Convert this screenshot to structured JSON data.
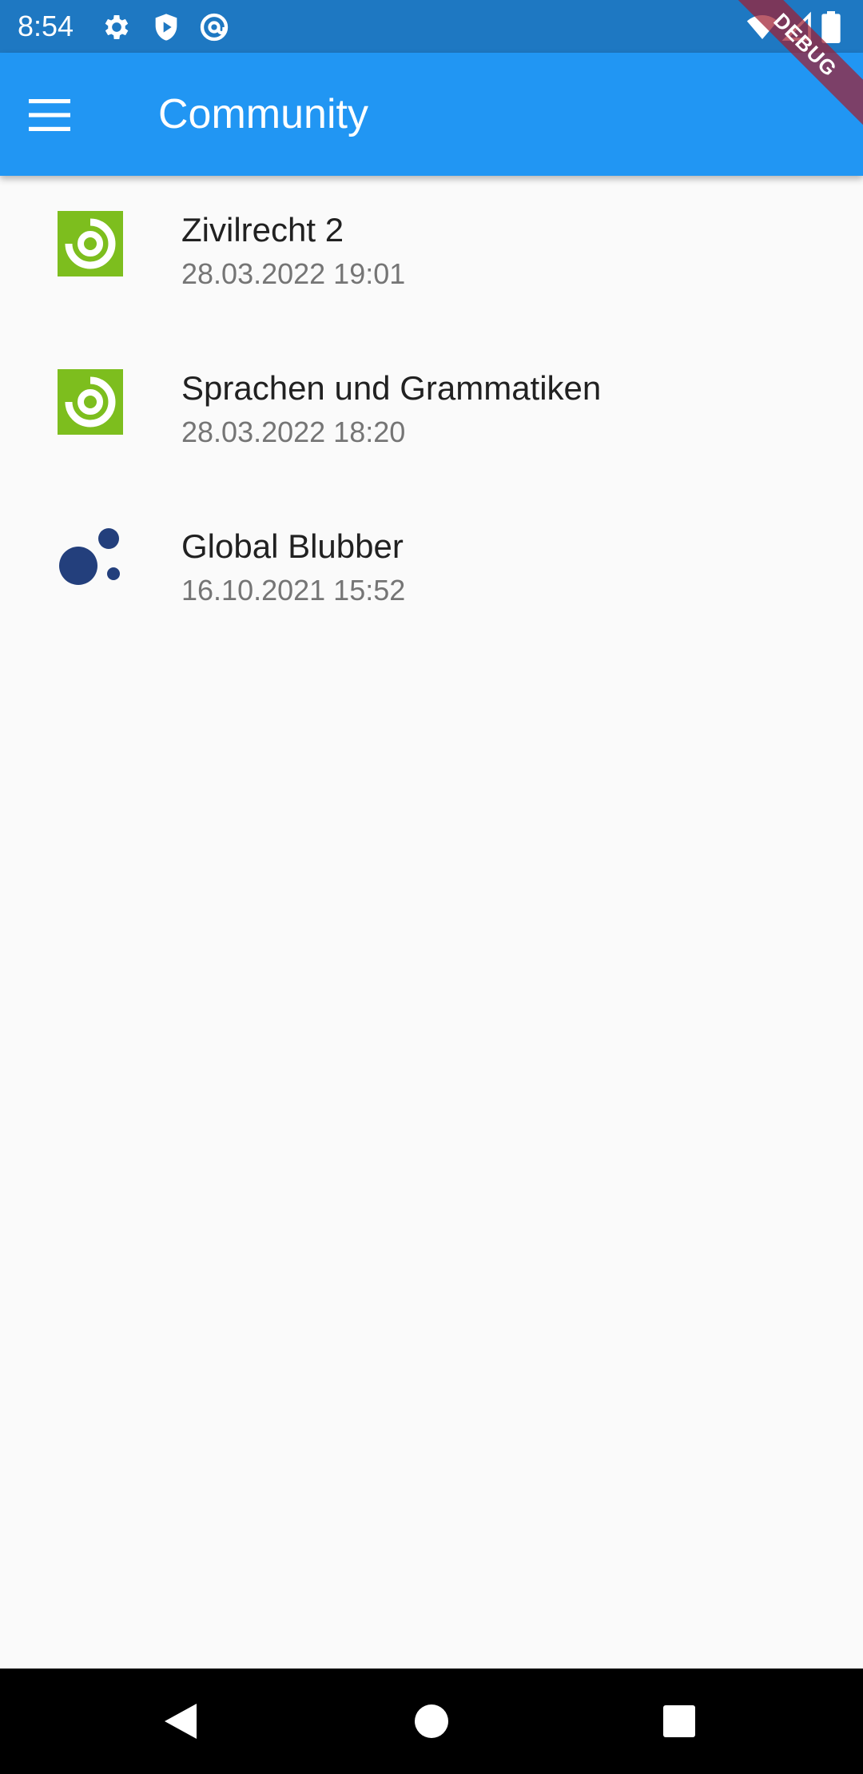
{
  "status_bar": {
    "time": "8:54",
    "icons": [
      "gear-icon",
      "shield-play-icon",
      "at-sign-icon",
      "wifi-icon",
      "signal-icon",
      "battery-icon"
    ]
  },
  "app_bar": {
    "title": "Community",
    "menu_icon": "hamburger-menu-icon"
  },
  "debug_banner": {
    "label": "DEBUG"
  },
  "communities": [
    {
      "name": "Zivilrecht 2",
      "date": "28.03.2022 19:01",
      "icon": "green-ring-logo-icon"
    },
    {
      "name": "Sprachen und Grammatiken",
      "date": "28.03.2022 18:20",
      "icon": "green-ring-logo-icon"
    },
    {
      "name": "Global Blubber",
      "date": "16.10.2021 15:52",
      "icon": "blue-dots-logo-icon"
    }
  ],
  "nav_bar": {
    "buttons": [
      "back-icon",
      "home-icon",
      "recents-icon"
    ]
  },
  "colors": {
    "status_bar": "#1E78C2",
    "app_bar": "#2196F3",
    "background": "#FAFAFA",
    "green_logo": "#7DBE1E",
    "blue_logo": "#233F7C",
    "debug_banner": "#A01E32"
  }
}
